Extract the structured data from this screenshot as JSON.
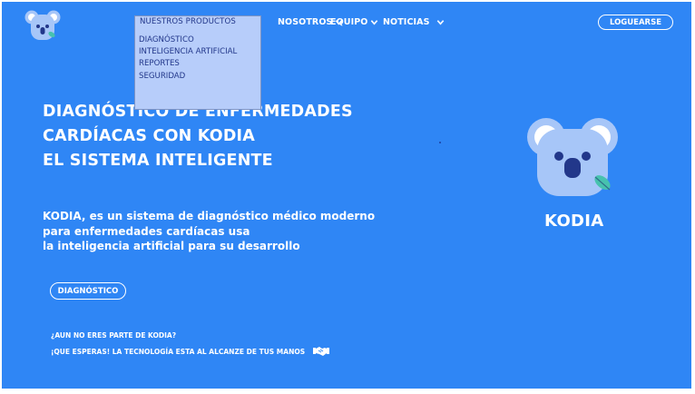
{
  "nav": {
    "nosotros": "NOSOTROS",
    "equipo": "EQUIPO",
    "noticias": "NOTICIAS"
  },
  "login_label": "LOGUEARSE",
  "dropdown": {
    "header": "NUESTROS PRODUCTOS",
    "items": [
      "DIAGNÓSTICO",
      "INTELIGENCIA ARTIFICIAL",
      "REPORTES",
      "SEGURIDAD"
    ]
  },
  "hero": {
    "title_lines": [
      "DIAGNÓSTICO DE ENFERMEDADES",
      "CARDÍACAS CON KODIA",
      "EL SISTEMA INTELIGENTE"
    ],
    "description_lines": [
      "KODIA, es un sistema de diagnóstico médico moderno",
      "para enfermedades cardíacas usa",
      "la inteligencia artificial para su desarrollo"
    ],
    "cta_button": "DIAGNÓSTICO",
    "join_question": "¿AUN NO ERES PARTE DE KODIA?",
    "join_tagline": "¡QUE ESPERAS! LA TECNOLOGÍA ESTA AL ALCANZE DE TUS MANOS"
  },
  "brand_name": "KODIA",
  "icons": {
    "logo": "koala-logo-icon",
    "chevron": "chevron-down-icon",
    "chevron_up": "chevron-up-icon",
    "handshake": "handshake-icon"
  },
  "colors": {
    "background": "#2f86f5",
    "dropdown_bg": "#b7cdfa",
    "dropdown_text": "#22378a",
    "koala_body": "#a7c6f8",
    "leaf": "#47c2ae"
  }
}
